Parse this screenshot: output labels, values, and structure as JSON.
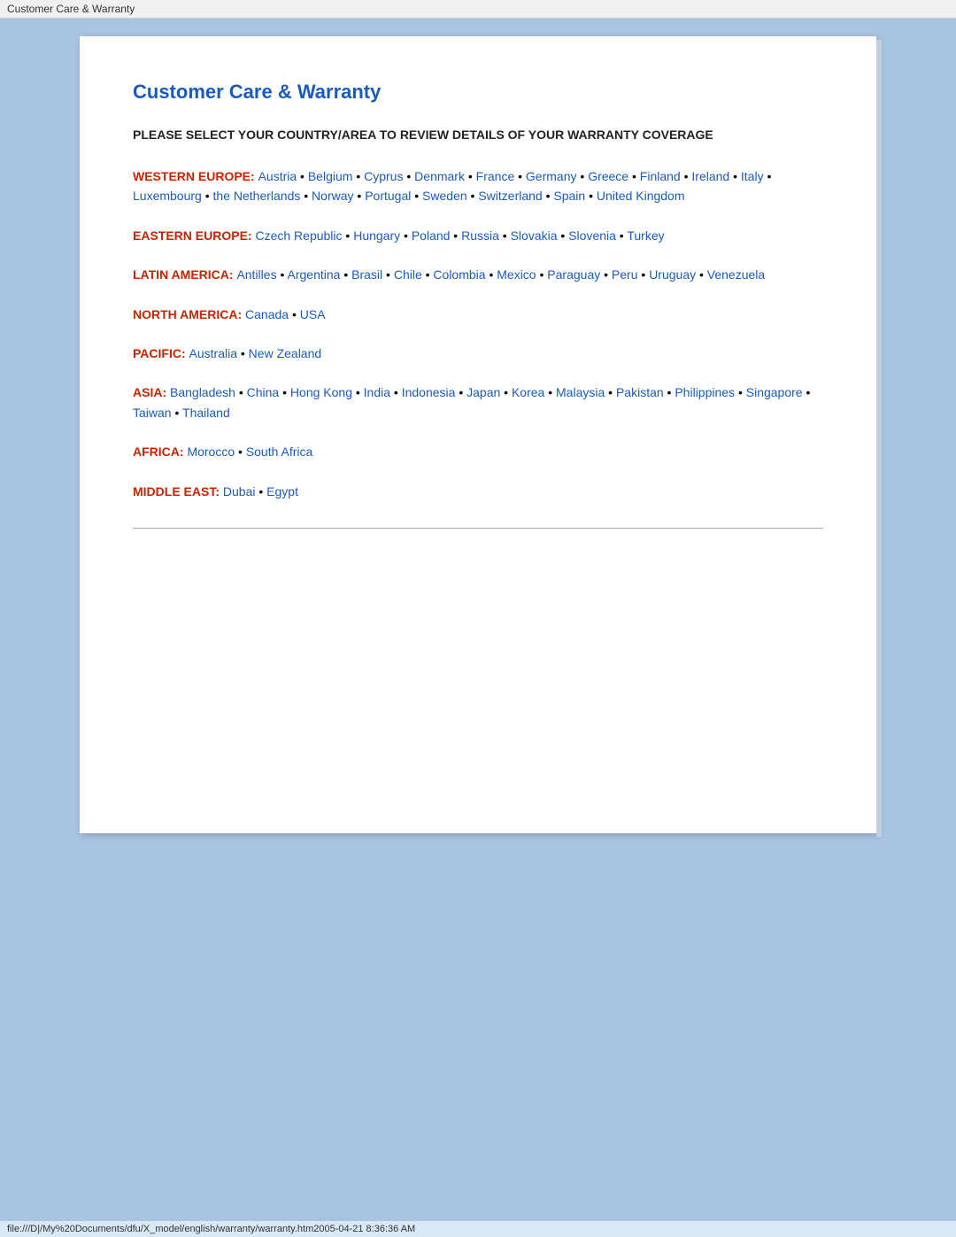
{
  "titleBar": {
    "text": "Customer Care & Warranty"
  },
  "page": {
    "title": "Customer Care & Warranty",
    "subtitle": "PLEASE SELECT YOUR COUNTRY/AREA TO REVIEW DETAILS OF YOUR WARRANTY COVERAGE",
    "regions": [
      {
        "id": "western-europe",
        "label": "WESTERN EUROPE:",
        "countries": [
          "Austria",
          "Belgium",
          "Cyprus",
          "Denmark",
          "France",
          "Germany",
          "Greece",
          "Finland",
          "Ireland",
          "Italy",
          "Luxembourg",
          "the Netherlands",
          "Norway",
          "Portugal",
          "Sweden",
          "Switzerland",
          "Spain",
          "United Kingdom"
        ]
      },
      {
        "id": "eastern-europe",
        "label": "EASTERN EUROPE:",
        "countries": [
          "Czech Republic",
          "Hungary",
          "Poland",
          "Russia",
          "Slovakia",
          "Slovenia",
          "Turkey"
        ]
      },
      {
        "id": "latin-america",
        "label": "LATIN AMERICA:",
        "countries": [
          "Antilles",
          "Argentina",
          "Brasil",
          "Chile",
          "Colombia",
          "Mexico",
          "Paraguay",
          "Peru",
          "Uruguay",
          "Venezuela"
        ]
      },
      {
        "id": "north-america",
        "label": "NORTH AMERICA:",
        "countries": [
          "Canada",
          "USA"
        ]
      },
      {
        "id": "pacific",
        "label": "PACIFIC:",
        "countries": [
          "Australia",
          "New Zealand"
        ]
      },
      {
        "id": "asia",
        "label": "ASIA:",
        "countries": [
          "Bangladesh",
          "China",
          "Hong Kong",
          "India",
          "Indonesia",
          "Japan",
          "Korea",
          "Malaysia",
          "Pakistan",
          "Philippines",
          "Singapore",
          "Taiwan",
          "Thailand"
        ]
      },
      {
        "id": "africa",
        "label": "AFRICA:",
        "countries": [
          "Morocco",
          "South Africa"
        ]
      },
      {
        "id": "middle-east",
        "label": "MIDDLE EAST:",
        "countries": [
          "Dubai",
          "Egypt"
        ]
      }
    ]
  },
  "statusBar": {
    "text": "file:///D|/My%20Documents/dfu/X_model/english/warranty/warranty.htm2005-04-21  8:36:36 AM"
  }
}
